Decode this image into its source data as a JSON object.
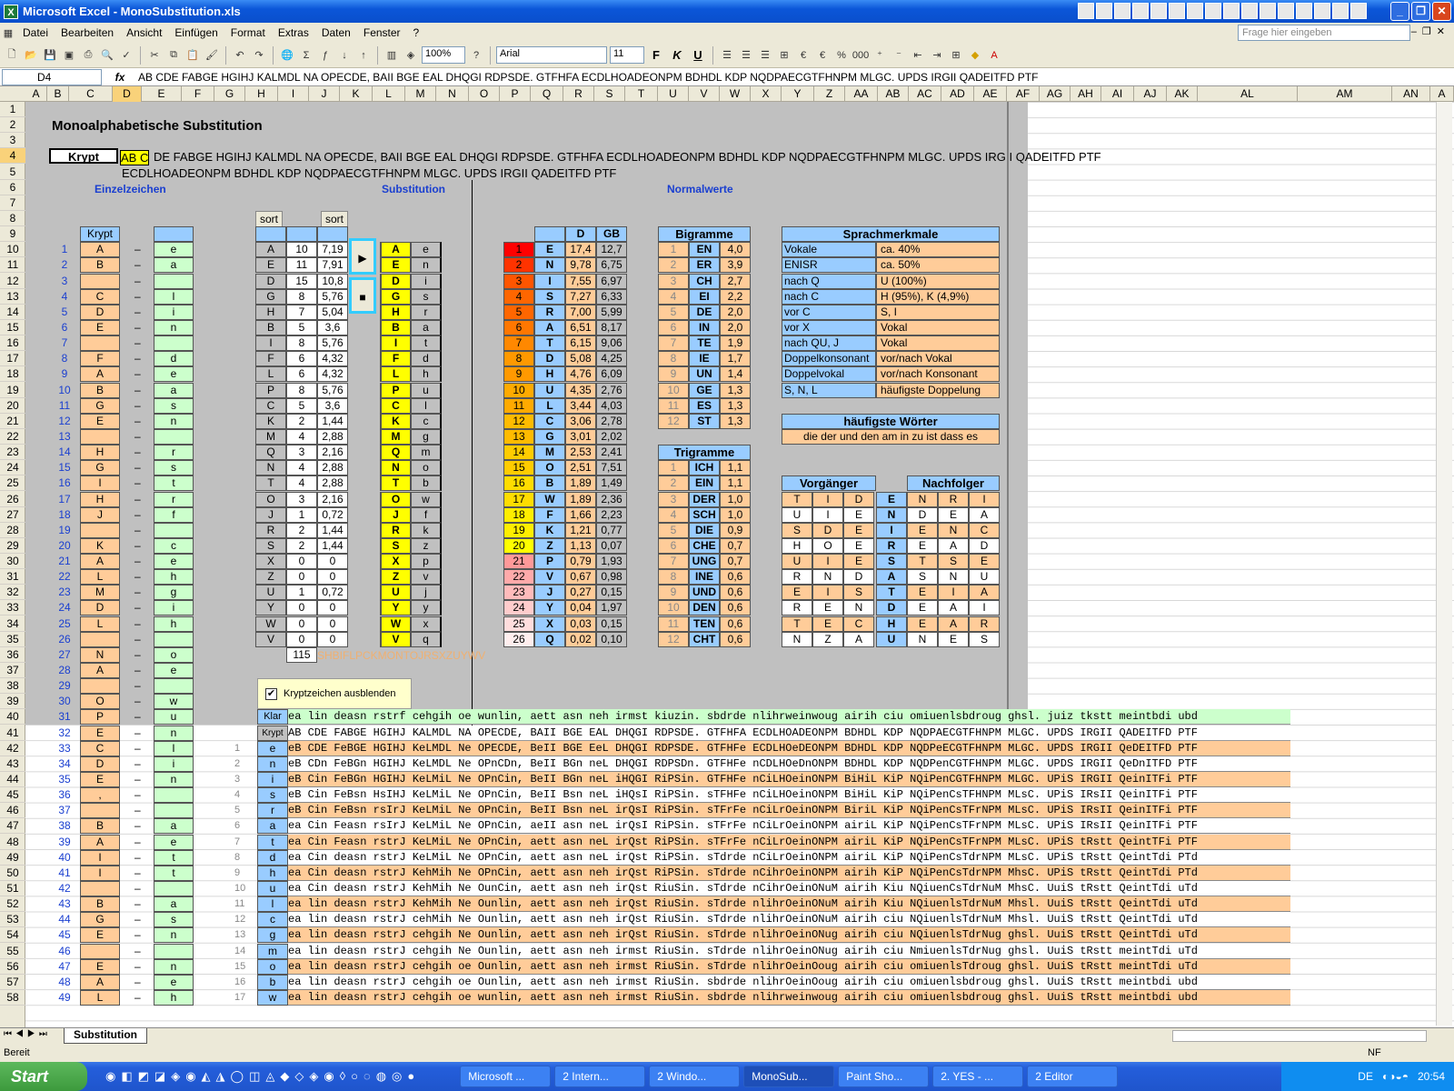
{
  "window": {
    "title": "Microsoft Excel - MonoSubstitution.xls"
  },
  "menu": [
    "Datei",
    "Bearbeiten",
    "Ansicht",
    "Einfügen",
    "Format",
    "Extras",
    "Daten",
    "Fenster",
    "?"
  ],
  "help_placeholder": "Frage hier eingeben",
  "toolbar": {
    "zoom": "100%",
    "font": "Arial",
    "size": "11"
  },
  "namebox": "D4",
  "formula": "AB CDE FABGE HGIHJ KALMDL NA OPECDE, BAII BGE EAL DHQGI RDPSDE. GTFHFA ECDLHOADEONPM BDHDL KDP NQDPAECGTFHNPM MLGC. UPDS IRGII QADEITFD PTF",
  "columns": [
    "A",
    "B",
    "C",
    "D",
    "E",
    "F",
    "G",
    "H",
    "I",
    "J",
    "K",
    "L",
    "M",
    "N",
    "O",
    "P",
    "Q",
    "R",
    "S",
    "T",
    "U",
    "V",
    "W",
    "X",
    "Y",
    "Z",
    "AA",
    "AB",
    "AC",
    "AD",
    "AE",
    "AF",
    "AG",
    "AH",
    "AI",
    "AJ",
    "AK",
    "AL",
    "AM",
    "AN",
    "A"
  ],
  "sheet": {
    "title": "Monoalphabetische Substitution",
    "krypt_label": "Krypt",
    "krypt_line1_sel": "AB C",
    "krypt_line1": "DE FABGE HGIHJ KALMDL NA OPECDE, BAII BGE EAL DHQGI RDPSDE. GTFHFA ECDLHOADEONPM BDHDL KDP NQDPAECGTFHNPM MLGC. UPDS IRGII QADEITFD PTF",
    "krypt_line2": "ECDLHOADEONPM BDHDL KDP NQDPAECGTFHNPM MLGC. UPDS IRGII QADEITFD PTF",
    "h_einzel": "Einzelzeichen",
    "h_subst": "Substitution",
    "h_normal": "Normalwerte",
    "sort": "sort",
    "krypt_col": "Krypt",
    "einzel": [
      [
        "1",
        "A",
        "e"
      ],
      [
        "2",
        "B",
        "a"
      ],
      [
        "3",
        "",
        ""
      ],
      [
        "4",
        "C",
        "l"
      ],
      [
        "5",
        "D",
        "i"
      ],
      [
        "6",
        "E",
        "n"
      ],
      [
        "7",
        "",
        ""
      ],
      [
        "8",
        "F",
        "d"
      ],
      [
        "9",
        "A",
        "e"
      ],
      [
        "10",
        "B",
        "a"
      ],
      [
        "11",
        "G",
        "s"
      ],
      [
        "12",
        "E",
        "n"
      ],
      [
        "13",
        "",
        ""
      ],
      [
        "14",
        "H",
        "r"
      ],
      [
        "15",
        "G",
        "s"
      ],
      [
        "16",
        "I",
        "t"
      ],
      [
        "17",
        "H",
        "r"
      ],
      [
        "18",
        "J",
        "f"
      ],
      [
        "19",
        "",
        ""
      ],
      [
        "20",
        "K",
        "c"
      ],
      [
        "21",
        "A",
        "e"
      ],
      [
        "22",
        "L",
        "h"
      ],
      [
        "23",
        "M",
        "g"
      ],
      [
        "24",
        "D",
        "i"
      ],
      [
        "25",
        "L",
        "h"
      ],
      [
        "26",
        "",
        ""
      ],
      [
        "27",
        "N",
        "o"
      ],
      [
        "28",
        "A",
        "e"
      ],
      [
        "29",
        "",
        ""
      ],
      [
        "30",
        "O",
        "w"
      ],
      [
        "31",
        "P",
        "u"
      ],
      [
        "32",
        "E",
        "n"
      ],
      [
        "33",
        "C",
        "l"
      ],
      [
        "34",
        "D",
        "i"
      ],
      [
        "35",
        "E",
        "n"
      ],
      [
        "36",
        ",",
        ""
      ],
      [
        "37",
        "",
        ""
      ],
      [
        "38",
        "B",
        "a"
      ],
      [
        "39",
        "A",
        "e"
      ],
      [
        "40",
        "I",
        "t"
      ],
      [
        "41",
        "I",
        "t"
      ],
      [
        "42",
        "",
        ""
      ],
      [
        "43",
        "B",
        "a"
      ],
      [
        "44",
        "G",
        "s"
      ],
      [
        "45",
        "E",
        "n"
      ],
      [
        "46",
        "",
        ""
      ],
      [
        "47",
        "E",
        "n"
      ],
      [
        "48",
        "A",
        "e"
      ],
      [
        "49",
        "L",
        "h"
      ]
    ],
    "dash": "–",
    "subst": [
      [
        "A",
        "10",
        "7,19",
        "A",
        "e"
      ],
      [
        "E",
        "11",
        "7,91",
        "E",
        "n"
      ],
      [
        "D",
        "15",
        "10,8",
        "D",
        "i"
      ],
      [
        "G",
        "8",
        "5,76",
        "G",
        "s"
      ],
      [
        "H",
        "7",
        "5,04",
        "H",
        "r"
      ],
      [
        "B",
        "5",
        "3,6",
        "B",
        "a"
      ],
      [
        "I",
        "8",
        "5,76",
        "I",
        "t"
      ],
      [
        "F",
        "6",
        "4,32",
        "F",
        "d"
      ],
      [
        "L",
        "6",
        "4,32",
        "L",
        "h"
      ],
      [
        "P",
        "8",
        "5,76",
        "P",
        "u"
      ],
      [
        "C",
        "5",
        "3,6",
        "C",
        "l"
      ],
      [
        "K",
        "2",
        "1,44",
        "K",
        "c"
      ],
      [
        "M",
        "4",
        "2,88",
        "M",
        "g"
      ],
      [
        "Q",
        "3",
        "2,16",
        "Q",
        "m"
      ],
      [
        "N",
        "4",
        "2,88",
        "N",
        "o"
      ],
      [
        "T",
        "4",
        "2,88",
        "T",
        "b"
      ],
      [
        "O",
        "3",
        "2,16",
        "O",
        "w"
      ],
      [
        "J",
        "1",
        "0,72",
        "J",
        "f"
      ],
      [
        "R",
        "2",
        "1,44",
        "R",
        "k"
      ],
      [
        "S",
        "2",
        "1,44",
        "S",
        "z"
      ],
      [
        "X",
        "0",
        "0",
        "X",
        "p"
      ],
      [
        "Z",
        "0",
        "0",
        "Z",
        "v"
      ],
      [
        "U",
        "1",
        "0,72",
        "U",
        "j"
      ],
      [
        "Y",
        "0",
        "0",
        "Y",
        "y"
      ],
      [
        "W",
        "0",
        "0",
        "W",
        "x"
      ],
      [
        "V",
        "0",
        "0",
        "V",
        "q"
      ]
    ],
    "subst_total": "115",
    "subst_tail": "SHBIFLPCKMONTOJRSXZUYWV",
    "play_icon": "▶",
    "stop_icon": "■",
    "freq_hdr": [
      "D",
      "GB"
    ],
    "freq": [
      [
        "1",
        "E",
        "17,4",
        "12,7"
      ],
      [
        "2",
        "N",
        "9,78",
        "6,75"
      ],
      [
        "3",
        "I",
        "7,55",
        "6,97"
      ],
      [
        "4",
        "S",
        "7,27",
        "6,33"
      ],
      [
        "5",
        "R",
        "7,00",
        "5,99"
      ],
      [
        "6",
        "A",
        "6,51",
        "8,17"
      ],
      [
        "7",
        "T",
        "6,15",
        "9,06"
      ],
      [
        "8",
        "D",
        "5,08",
        "4,25"
      ],
      [
        "9",
        "H",
        "4,76",
        "6,09"
      ],
      [
        "10",
        "U",
        "4,35",
        "2,76"
      ],
      [
        "11",
        "L",
        "3,44",
        "4,03"
      ],
      [
        "12",
        "C",
        "3,06",
        "2,78"
      ],
      [
        "13",
        "G",
        "3,01",
        "2,02"
      ],
      [
        "14",
        "M",
        "2,53",
        "2,41"
      ],
      [
        "15",
        "O",
        "2,51",
        "7,51"
      ],
      [
        "16",
        "B",
        "1,89",
        "1,49"
      ],
      [
        "17",
        "W",
        "1,89",
        "2,36"
      ],
      [
        "18",
        "F",
        "1,66",
        "2,23"
      ],
      [
        "19",
        "K",
        "1,21",
        "0,77"
      ],
      [
        "20",
        "Z",
        "1,13",
        "0,07"
      ],
      [
        "21",
        "P",
        "0,79",
        "1,93"
      ],
      [
        "22",
        "V",
        "0,67",
        "0,98"
      ],
      [
        "23",
        "J",
        "0,27",
        "0,15"
      ],
      [
        "24",
        "Y",
        "0,04",
        "1,97"
      ],
      [
        "25",
        "X",
        "0,03",
        "0,15"
      ],
      [
        "26",
        "Q",
        "0,02",
        "0,10"
      ]
    ],
    "freq_colors": [
      "#ff0000",
      "#ff3300",
      "#ff5500",
      "#ff6600",
      "#ff6600",
      "#ff7700",
      "#ff8800",
      "#ff9900",
      "#ff9900",
      "#ffaa00",
      "#ffaa00",
      "#ffbb00",
      "#ffbb00",
      "#ffcc00",
      "#ffcc00",
      "#ffdd00",
      "#ffdd00",
      "#ffee00",
      "#ffee00",
      "#ffff00",
      "#ff9999",
      "#ffaaaa",
      "#ffbbbb",
      "#ffcccc",
      "#ffdddd",
      "#ffeeee"
    ],
    "bigramme_title": "Bigramme",
    "bigramme": [
      [
        "1",
        "EN",
        "4,0"
      ],
      [
        "2",
        "ER",
        "3,9"
      ],
      [
        "3",
        "CH",
        "2,7"
      ],
      [
        "4",
        "EI",
        "2,2"
      ],
      [
        "5",
        "DE",
        "2,0"
      ],
      [
        "6",
        "IN",
        "2,0"
      ],
      [
        "7",
        "TE",
        "1,9"
      ],
      [
        "8",
        "IE",
        "1,7"
      ],
      [
        "9",
        "UN",
        "1,4"
      ],
      [
        "10",
        "GE",
        "1,3"
      ],
      [
        "11",
        "ES",
        "1,3"
      ],
      [
        "12",
        "ST",
        "1,3"
      ]
    ],
    "trigramme_title": "Trigramme",
    "trigramme": [
      [
        "1",
        "ICH",
        "1,1"
      ],
      [
        "2",
        "EIN",
        "1,1"
      ],
      [
        "3",
        "DER",
        "1,0"
      ],
      [
        "4",
        "SCH",
        "1,0"
      ],
      [
        "5",
        "DIE",
        "0,9"
      ],
      [
        "6",
        "CHE",
        "0,7"
      ],
      [
        "7",
        "UNG",
        "0,7"
      ],
      [
        "8",
        "INE",
        "0,6"
      ],
      [
        "9",
        "UND",
        "0,6"
      ],
      [
        "10",
        "DEN",
        "0,6"
      ],
      [
        "11",
        "TEN",
        "0,6"
      ],
      [
        "12",
        "CHT",
        "0,6"
      ]
    ],
    "sprach_title": "Sprachmerkmale",
    "sprach": [
      [
        "Vokale",
        "ca. 40%"
      ],
      [
        "ENISR",
        "ca. 50%"
      ],
      [
        "nach Q",
        "U (100%)"
      ],
      [
        "nach C",
        "H (95%), K (4,9%)"
      ],
      [
        "vor C",
        "S, I"
      ],
      [
        "vor X",
        "Vokal"
      ],
      [
        "nach QU, J",
        "Vokal"
      ],
      [
        "Doppelkonsonant",
        "vor/nach Vokal"
      ],
      [
        "Doppelvokal",
        "vor/nach Konsonant"
      ],
      [
        "S, N, L",
        "häufigste Doppelung"
      ]
    ],
    "woerter_title": "häufigste Wörter",
    "woerter": "die der und den am in zu ist dass es",
    "vor_title": "Vorgänger",
    "nach_title": "Nachfolger",
    "vn": [
      [
        "T",
        "I",
        "D",
        "E",
        "N",
        "R",
        "I"
      ],
      [
        "U",
        "I",
        "E",
        "N",
        "D",
        "E",
        "A"
      ],
      [
        "S",
        "D",
        "E",
        "I",
        "E",
        "N",
        "C"
      ],
      [
        "H",
        "O",
        "E",
        "R",
        "E",
        "A",
        "D"
      ],
      [
        "U",
        "I",
        "E",
        "S",
        "T",
        "S",
        "E"
      ],
      [
        "R",
        "N",
        "D",
        "A",
        "S",
        "N",
        "U"
      ],
      [
        "E",
        "I",
        "S",
        "T",
        "E",
        "I",
        "A"
      ],
      [
        "R",
        "E",
        "N",
        "D",
        "E",
        "A",
        "I"
      ],
      [
        "T",
        "E",
        "C",
        "H",
        "E",
        "A",
        "R"
      ],
      [
        "N",
        "Z",
        "A",
        "U",
        "N",
        "E",
        "S"
      ]
    ],
    "checkbox_label": "Kryptzeichen ausblenden",
    "klar_label": "Klar",
    "krypt_row_label": "Krypt",
    "klar": "ea lin deasn rstrf cehgih oe wunlin, aett asn neh irmst kiuzin. sbdrde nlihrweinwoug airih ciu omiuenlsbdroug ghsl. juiz tkstt meintbdi ubd",
    "krypt_row": "AB CDE FABGE HGIHJ KALMDL NA OPECDE, BAII BGE EAL DHQGI RDPSDE. GTFHFA ECDLHOADEONPM BDHDL KDP NQDPAECGTFHNPM MLGC. UPDS IRGII QADEITFD PTF",
    "steps": [
      [
        "1",
        "e",
        "eB CDE FeBGE HGIHJ KeLMDL Ne OPECDE, BeII BGE EeL DHQGI RDPSDE. GTFHFe ECDLHOeDEONPM BDHDL KDP NQDPeECGTFHNPM MLGC. UPDS IRGII QeDEITFD PTF"
      ],
      [
        "2",
        "n",
        "eB CDn FeBGn HGIHJ KeLMDL Ne OPnCDn, BeII BGn neL DHQGI RDPSDn. GTFHFe nCDLHOeDnONPM BDHDL KDP NQDPenCGTFHNPM MLGC. UPDS IRGII QeDnITFD PTF"
      ],
      [
        "3",
        "i",
        "eB Cin FeBGn HGIHJ KeLMiL Ne OPnCin, BeII BGn neL iHQGI RiPSin. GTFHFe nCiLHOeinONPM BiHiL KiP NQiPenCGTFHNPM MLGC. UPiS IRGII QeinITFi PTF"
      ],
      [
        "4",
        "s",
        "eB Cin FeBsn HsIHJ KeLMiL Ne OPnCin, BeII Bsn neL iHQsI RiPSin. sTFHFe nCiLHOeinONPM BiHiL KiP NQiPenCsTFHNPM MLsC. UPiS IRsII QeinITFi PTF"
      ],
      [
        "5",
        "r",
        "eB Cin FeBsn rsIrJ KeLMiL Ne OPnCin, BeII Bsn neL irQsI RiPSin. sTFrFe nCiLrOeinONPM BiriL KiP NQiPenCsTFrNPM MLsC. UPiS IRsII QeinITFi PTF"
      ],
      [
        "6",
        "a",
        "ea Cin Feasn rsIrJ KeLMiL Ne OPnCin, aeII asn neL irQsI RiPSin. sTFrFe nCiLrOeinONPM airiL KiP NQiPenCsTFrNPM MLsC. UPiS IRsII QeinITFi PTF"
      ],
      [
        "7",
        "t",
        "ea Cin Feasn rstrJ KeLMiL Ne OPnCin, aett asn neL irQst RiPSin. sTFrFe nCiLrOeinONPM airiL KiP NQiPenCsTFrNPM MLsC. UPiS tRstt QeintTFi PTF"
      ],
      [
        "8",
        "d",
        "ea Cin deasn rstrJ KeLMiL Ne OPnCin, aett asn neL irQst RiPSin. sTdrde nCiLrOeinONPM airiL KiP NQiPenCsTdrNPM MLsC. UPiS tRstt QeintTdi PTd"
      ],
      [
        "9",
        "h",
        "ea Cin deasn rstrJ KehMih Ne OPnCin, aett asn neh irQst RiPSin. sTdrde nCihrOeinONPM airih KiP NQiPenCsTdrNPM MhsC. UPiS tRstt QeintTdi PTd"
      ],
      [
        "10",
        "u",
        "ea Cin deasn rstrJ KehMih Ne OunCin, aett asn neh irQst RiuSin. sTdrde nCihrOeinONuM airih Kiu NQiuenCsTdrNuM MhsC. UuiS tRstt QeintTdi uTd"
      ],
      [
        "11",
        "l",
        "ea lin deasn rstrJ KehMih Ne Ounlin, aett asn neh irQst RiuSin. sTdrde nlihrOeinONuM airih Kiu NQiuenlsTdrNuM Mhsl. UuiS tRstt QeintTdi uTd"
      ],
      [
        "12",
        "c",
        "ea lin deasn rstrJ cehMih Ne Ounlin, aett asn neh irQst RiuSin. sTdrde nlihrOeinONuM airih ciu NQiuenlsTdrNuM Mhsl. UuiS tRstt QeintTdi uTd"
      ],
      [
        "13",
        "g",
        "ea lin deasn rstrJ cehgih Ne Ounlin, aett asn neh irQst RiuSin. sTdrde nlihrOeinONug airih ciu NQiuenlsTdrNug ghsl. UuiS tRstt QeintTdi uTd"
      ],
      [
        "14",
        "m",
        "ea lin deasn rstrJ cehgih Ne Ounlin, aett asn neh irmst RiuSin. sTdrde nlihrOeinONug airih ciu NmiuenlsTdrNug ghsl. UuiS tRstt meintTdi uTd"
      ],
      [
        "15",
        "o",
        "ea lin deasn rstrJ cehgih oe Ounlin, aett asn neh irmst RiuSin. sTdrde nlihrOeinOoug airih ciu omiuenlsTdroug ghsl. UuiS tRstt meintTdi uTd"
      ],
      [
        "16",
        "b",
        "ea lin deasn rstrJ cehgih oe Ounlin, aett asn neh irmst RiuSin. sbdrde nlihrOeinOoug airih ciu omiuenlsbdroug ghsl. UuiS tRstt meintbdi ubd"
      ],
      [
        "17",
        "w",
        "ea lin deasn rstrJ cehgih oe wunlin, aett asn neh irmst RiuSin. sbdrde nlihrweinwoug airih ciu omiuenlsbdroug ghsl. UuiS tRstt meintbdi ubd"
      ]
    ],
    "sheet_tab": "Substitution"
  },
  "status": "Bereit",
  "status_nf": "NF",
  "taskbar": {
    "start": "Start",
    "tasks": [
      "Microsoft ...",
      "2 Intern...",
      "2 Windo...",
      "MonoSub...",
      "Paint Sho...",
      "2. YES - ...",
      "2 Editor"
    ],
    "lang": "DE",
    "clock": "20:54"
  }
}
